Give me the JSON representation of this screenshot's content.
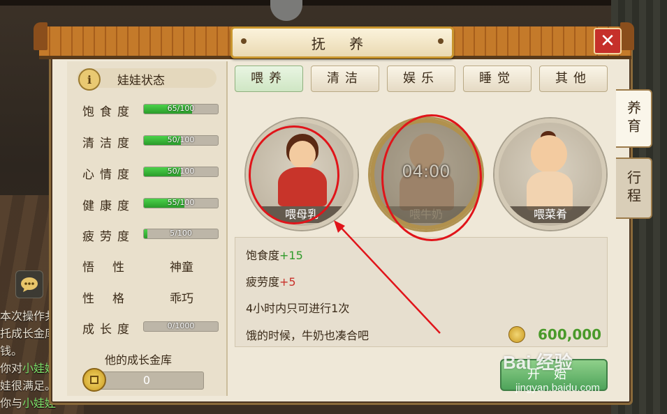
{
  "window": {
    "title": "抚 养",
    "close_label": "✕"
  },
  "status": {
    "header": "娃娃状态",
    "bars": [
      {
        "label": "饱食度",
        "value": 65,
        "max": 100,
        "text": "65/100"
      },
      {
        "label": "清洁度",
        "value": 50,
        "max": 100,
        "text": "50/100"
      },
      {
        "label": "心情度",
        "value": 50,
        "max": 100,
        "text": "50/100"
      },
      {
        "label": "健康度",
        "value": 55,
        "max": 100,
        "text": "55/100"
      },
      {
        "label": "疲劳度",
        "value": 5,
        "max": 100,
        "text": "5/100"
      }
    ],
    "wukong_label": "悟性",
    "wukong_value": "神童",
    "xingge_label": "性格",
    "xingge_value": "乖巧",
    "growth": {
      "label": "成长度",
      "value": 0,
      "max": 1000,
      "text": "0/1000"
    },
    "vault_title": "他的成长金库",
    "vault_value": "0"
  },
  "tabs": [
    "喂养",
    "清洁",
    "娱乐",
    "睡觉",
    "其他"
  ],
  "active_tab": 0,
  "side_tabs": [
    "养育",
    "行程"
  ],
  "foods": [
    {
      "label": "喂母乳",
      "cooldown": ""
    },
    {
      "label": "喂牛奶",
      "cooldown": "04:00"
    },
    {
      "label": "喂菜肴",
      "cooldown": ""
    }
  ],
  "info": {
    "line1_name": "饱食度",
    "line1_delta": "+15",
    "line2_name": "疲劳度",
    "line2_delta": "+5",
    "line3": "4小时内只可进行1次",
    "line4": "饿的时候，牛奶也凑合吧",
    "price": "600,000"
  },
  "start_button": "开始",
  "chat": {
    "lines": [
      "本次操作共",
      "托成长金库",
      "钱。",
      "你对小娃娃",
      "娃很满足。",
      "你与小娃娃"
    ]
  },
  "watermark": {
    "main": "Bai 经验",
    "sub": "jingyan.baidu.com"
  },
  "colors": {
    "accent_green": "#2e9a2a",
    "accent_red": "#c8302a",
    "frame_brown": "#8a6a3a",
    "annotation_red": "#e0141a"
  }
}
